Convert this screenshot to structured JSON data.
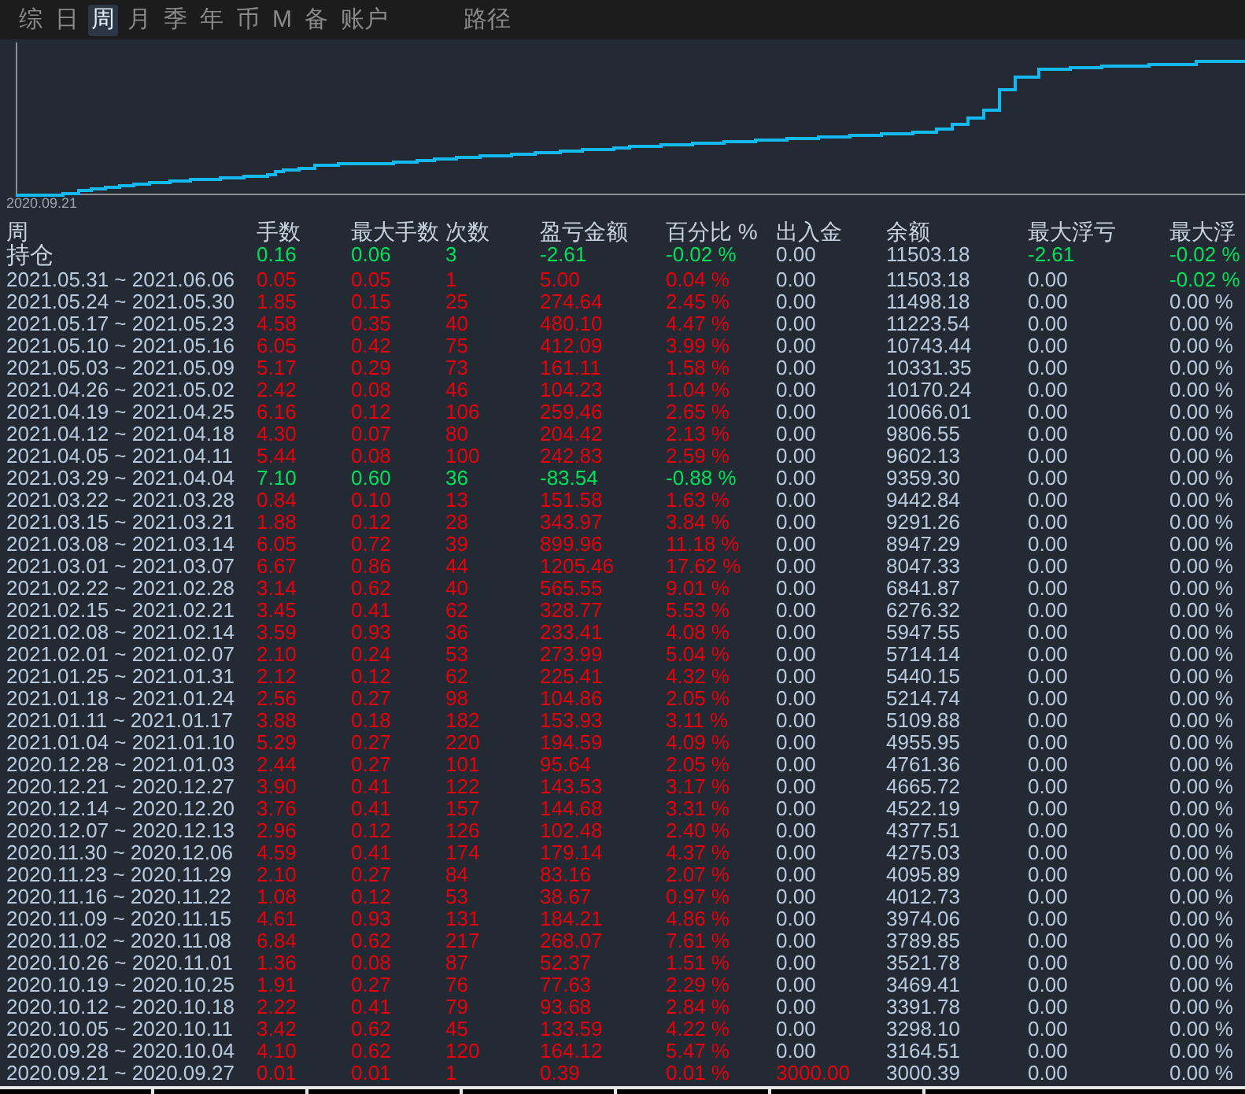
{
  "tabs": [
    {
      "label": "综",
      "selected": false
    },
    {
      "label": "日",
      "selected": false
    },
    {
      "label": "周",
      "selected": true
    },
    {
      "label": "月",
      "selected": false
    },
    {
      "label": "季",
      "selected": false
    },
    {
      "label": "年",
      "selected": false
    },
    {
      "label": "币",
      "selected": false
    },
    {
      "label": "M",
      "selected": false
    },
    {
      "label": "备",
      "selected": false
    },
    {
      "label": "账户",
      "selected": false
    }
  ],
  "path_tab": {
    "label": "路径",
    "selected": false
  },
  "chart": {
    "x_label": "2020.09.21"
  },
  "table": {
    "columns": [
      "周",
      "手数",
      "最大手数",
      "次数",
      "盈亏金额",
      "百分比 %",
      "出入金",
      "余额",
      "最大浮亏",
      "最大浮"
    ],
    "rows": [
      {
        "period": "持仓",
        "negative": true,
        "lots": "0.16",
        "max_lots": "0.06",
        "count": "3",
        "profit": "-2.61",
        "percent": "-0.02 %",
        "deposit": "0.00",
        "deposit_moved": false,
        "balance": "11503.18",
        "max_float": "-2.61",
        "float_negative": true,
        "max_float_pct": "-0.02 %",
        "float_pct_negative": true
      },
      {
        "period": "2021.05.31 ~ 2021.06.06",
        "negative": false,
        "lots": "0.05",
        "max_lots": "0.05",
        "count": "1",
        "profit": "5.00",
        "percent": "0.04 %",
        "deposit": "0.00",
        "deposit_moved": false,
        "balance": "11503.18",
        "max_float": "0.00",
        "float_negative": false,
        "max_float_pct": "-0.02 %",
        "float_pct_negative": true
      },
      {
        "period": "2021.05.24 ~ 2021.05.30",
        "negative": false,
        "lots": "1.85",
        "max_lots": "0.15",
        "count": "25",
        "profit": "274.64",
        "percent": "2.45 %",
        "deposit": "0.00",
        "deposit_moved": false,
        "balance": "11498.18",
        "max_float": "0.00",
        "float_negative": false,
        "max_float_pct": "0.00 %",
        "float_pct_negative": false
      },
      {
        "period": "2021.05.17 ~ 2021.05.23",
        "negative": false,
        "lots": "4.58",
        "max_lots": "0.35",
        "count": "40",
        "profit": "480.10",
        "percent": "4.47 %",
        "deposit": "0.00",
        "deposit_moved": false,
        "balance": "11223.54",
        "max_float": "0.00",
        "float_negative": false,
        "max_float_pct": "0.00 %",
        "float_pct_negative": false
      },
      {
        "period": "2021.05.10 ~ 2021.05.16",
        "negative": false,
        "lots": "6.05",
        "max_lots": "0.42",
        "count": "75",
        "profit": "412.09",
        "percent": "3.99 %",
        "deposit": "0.00",
        "deposit_moved": false,
        "balance": "10743.44",
        "max_float": "0.00",
        "float_negative": false,
        "max_float_pct": "0.00 %",
        "float_pct_negative": false
      },
      {
        "period": "2021.05.03 ~ 2021.05.09",
        "negative": false,
        "lots": "5.17",
        "max_lots": "0.29",
        "count": "73",
        "profit": "161.11",
        "percent": "1.58 %",
        "deposit": "0.00",
        "deposit_moved": false,
        "balance": "10331.35",
        "max_float": "0.00",
        "float_negative": false,
        "max_float_pct": "0.00 %",
        "float_pct_negative": false
      },
      {
        "period": "2021.04.26 ~ 2021.05.02",
        "negative": false,
        "lots": "2.42",
        "max_lots": "0.08",
        "count": "46",
        "profit": "104.23",
        "percent": "1.04 %",
        "deposit": "0.00",
        "deposit_moved": false,
        "balance": "10170.24",
        "max_float": "0.00",
        "float_negative": false,
        "max_float_pct": "0.00 %",
        "float_pct_negative": false
      },
      {
        "period": "2021.04.19 ~ 2021.04.25",
        "negative": false,
        "lots": "6.16",
        "max_lots": "0.12",
        "count": "106",
        "profit": "259.46",
        "percent": "2.65 %",
        "deposit": "0.00",
        "deposit_moved": false,
        "balance": "10066.01",
        "max_float": "0.00",
        "float_negative": false,
        "max_float_pct": "0.00 %",
        "float_pct_negative": false
      },
      {
        "period": "2021.04.12 ~ 2021.04.18",
        "negative": false,
        "lots": "4.30",
        "max_lots": "0.07",
        "count": "80",
        "profit": "204.42",
        "percent": "2.13 %",
        "deposit": "0.00",
        "deposit_moved": false,
        "balance": "9806.55",
        "max_float": "0.00",
        "float_negative": false,
        "max_float_pct": "0.00 %",
        "float_pct_negative": false
      },
      {
        "period": "2021.04.05 ~ 2021.04.11",
        "negative": false,
        "lots": "5.44",
        "max_lots": "0.08",
        "count": "100",
        "profit": "242.83",
        "percent": "2.59 %",
        "deposit": "0.00",
        "deposit_moved": false,
        "balance": "9602.13",
        "max_float": "0.00",
        "float_negative": false,
        "max_float_pct": "0.00 %",
        "float_pct_negative": false
      },
      {
        "period": "2021.03.29 ~ 2021.04.04",
        "negative": true,
        "lots": "7.10",
        "max_lots": "0.60",
        "count": "36",
        "profit": "-83.54",
        "percent": "-0.88 %",
        "deposit": "0.00",
        "deposit_moved": false,
        "balance": "9359.30",
        "max_float": "0.00",
        "float_negative": false,
        "max_float_pct": "0.00 %",
        "float_pct_negative": false
      },
      {
        "period": "2021.03.22 ~ 2021.03.28",
        "negative": false,
        "lots": "0.84",
        "max_lots": "0.10",
        "count": "13",
        "profit": "151.58",
        "percent": "1.63 %",
        "deposit": "0.00",
        "deposit_moved": false,
        "balance": "9442.84",
        "max_float": "0.00",
        "float_negative": false,
        "max_float_pct": "0.00 %",
        "float_pct_negative": false
      },
      {
        "period": "2021.03.15 ~ 2021.03.21",
        "negative": false,
        "lots": "1.88",
        "max_lots": "0.12",
        "count": "28",
        "profit": "343.97",
        "percent": "3.84 %",
        "deposit": "0.00",
        "deposit_moved": false,
        "balance": "9291.26",
        "max_float": "0.00",
        "float_negative": false,
        "max_float_pct": "0.00 %",
        "float_pct_negative": false
      },
      {
        "period": "2021.03.08 ~ 2021.03.14",
        "negative": false,
        "lots": "6.05",
        "max_lots": "0.72",
        "count": "39",
        "profit": "899.96",
        "percent": "11.18 %",
        "deposit": "0.00",
        "deposit_moved": false,
        "balance": "8947.29",
        "max_float": "0.00",
        "float_negative": false,
        "max_float_pct": "0.00 %",
        "float_pct_negative": false
      },
      {
        "period": "2021.03.01 ~ 2021.03.07",
        "negative": false,
        "lots": "6.67",
        "max_lots": "0.86",
        "count": "44",
        "profit": "1205.46",
        "percent": "17.62 %",
        "deposit": "0.00",
        "deposit_moved": false,
        "balance": "8047.33",
        "max_float": "0.00",
        "float_negative": false,
        "max_float_pct": "0.00 %",
        "float_pct_negative": false
      },
      {
        "period": "2021.02.22 ~ 2021.02.28",
        "negative": false,
        "lots": "3.14",
        "max_lots": "0.62",
        "count": "40",
        "profit": "565.55",
        "percent": "9.01 %",
        "deposit": "0.00",
        "deposit_moved": false,
        "balance": "6841.87",
        "max_float": "0.00",
        "float_negative": false,
        "max_float_pct": "0.00 %",
        "float_pct_negative": false
      },
      {
        "period": "2021.02.15 ~ 2021.02.21",
        "negative": false,
        "lots": "3.45",
        "max_lots": "0.41",
        "count": "62",
        "profit": "328.77",
        "percent": "5.53 %",
        "deposit": "0.00",
        "deposit_moved": false,
        "balance": "6276.32",
        "max_float": "0.00",
        "float_negative": false,
        "max_float_pct": "0.00 %",
        "float_pct_negative": false
      },
      {
        "period": "2021.02.08 ~ 2021.02.14",
        "negative": false,
        "lots": "3.59",
        "max_lots": "0.93",
        "count": "36",
        "profit": "233.41",
        "percent": "4.08 %",
        "deposit": "0.00",
        "deposit_moved": false,
        "balance": "5947.55",
        "max_float": "0.00",
        "float_negative": false,
        "max_float_pct": "0.00 %",
        "float_pct_negative": false
      },
      {
        "period": "2021.02.01 ~ 2021.02.07",
        "negative": false,
        "lots": "2.10",
        "max_lots": "0.24",
        "count": "53",
        "profit": "273.99",
        "percent": "5.04 %",
        "deposit": "0.00",
        "deposit_moved": false,
        "balance": "5714.14",
        "max_float": "0.00",
        "float_negative": false,
        "max_float_pct": "0.00 %",
        "float_pct_negative": false
      },
      {
        "period": "2021.01.25 ~ 2021.01.31",
        "negative": false,
        "lots": "2.12",
        "max_lots": "0.12",
        "count": "62",
        "profit": "225.41",
        "percent": "4.32 %",
        "deposit": "0.00",
        "deposit_moved": false,
        "balance": "5440.15",
        "max_float": "0.00",
        "float_negative": false,
        "max_float_pct": "0.00 %",
        "float_pct_negative": false
      },
      {
        "period": "2021.01.18 ~ 2021.01.24",
        "negative": false,
        "lots": "2.56",
        "max_lots": "0.27",
        "count": "98",
        "profit": "104.86",
        "percent": "2.05 %",
        "deposit": "0.00",
        "deposit_moved": false,
        "balance": "5214.74",
        "max_float": "0.00",
        "float_negative": false,
        "max_float_pct": "0.00 %",
        "float_pct_negative": false
      },
      {
        "period": "2021.01.11 ~ 2021.01.17",
        "negative": false,
        "lots": "3.88",
        "max_lots": "0.18",
        "count": "182",
        "profit": "153.93",
        "percent": "3.11 %",
        "deposit": "0.00",
        "deposit_moved": false,
        "balance": "5109.88",
        "max_float": "0.00",
        "float_negative": false,
        "max_float_pct": "0.00 %",
        "float_pct_negative": false
      },
      {
        "period": "2021.01.04 ~ 2021.01.10",
        "negative": false,
        "lots": "5.29",
        "max_lots": "0.27",
        "count": "220",
        "profit": "194.59",
        "percent": "4.09 %",
        "deposit": "0.00",
        "deposit_moved": false,
        "balance": "4955.95",
        "max_float": "0.00",
        "float_negative": false,
        "max_float_pct": "0.00 %",
        "float_pct_negative": false
      },
      {
        "period": "2020.12.28 ~ 2021.01.03",
        "negative": false,
        "lots": "2.44",
        "max_lots": "0.27",
        "count": "101",
        "profit": "95.64",
        "percent": "2.05 %",
        "deposit": "0.00",
        "deposit_moved": false,
        "balance": "4761.36",
        "max_float": "0.00",
        "float_negative": false,
        "max_float_pct": "0.00 %",
        "float_pct_negative": false
      },
      {
        "period": "2020.12.21 ~ 2020.12.27",
        "negative": false,
        "lots": "3.90",
        "max_lots": "0.41",
        "count": "122",
        "profit": "143.53",
        "percent": "3.17 %",
        "deposit": "0.00",
        "deposit_moved": false,
        "balance": "4665.72",
        "max_float": "0.00",
        "float_negative": false,
        "max_float_pct": "0.00 %",
        "float_pct_negative": false
      },
      {
        "period": "2020.12.14 ~ 2020.12.20",
        "negative": false,
        "lots": "3.76",
        "max_lots": "0.41",
        "count": "157",
        "profit": "144.68",
        "percent": "3.31 %",
        "deposit": "0.00",
        "deposit_moved": false,
        "balance": "4522.19",
        "max_float": "0.00",
        "float_negative": false,
        "max_float_pct": "0.00 %",
        "float_pct_negative": false
      },
      {
        "period": "2020.12.07 ~ 2020.12.13",
        "negative": false,
        "lots": "2.96",
        "max_lots": "0.12",
        "count": "126",
        "profit": "102.48",
        "percent": "2.40 %",
        "deposit": "0.00",
        "deposit_moved": false,
        "balance": "4377.51",
        "max_float": "0.00",
        "float_negative": false,
        "max_float_pct": "0.00 %",
        "float_pct_negative": false
      },
      {
        "period": "2020.11.30 ~ 2020.12.06",
        "negative": false,
        "lots": "4.59",
        "max_lots": "0.41",
        "count": "174",
        "profit": "179.14",
        "percent": "4.37 %",
        "deposit": "0.00",
        "deposit_moved": false,
        "balance": "4275.03",
        "max_float": "0.00",
        "float_negative": false,
        "max_float_pct": "0.00 %",
        "float_pct_negative": false
      },
      {
        "period": "2020.11.23 ~ 2020.11.29",
        "negative": false,
        "lots": "2.10",
        "max_lots": "0.27",
        "count": "84",
        "profit": "83.16",
        "percent": "2.07 %",
        "deposit": "0.00",
        "deposit_moved": false,
        "balance": "4095.89",
        "max_float": "0.00",
        "float_negative": false,
        "max_float_pct": "0.00 %",
        "float_pct_negative": false
      },
      {
        "period": "2020.11.16 ~ 2020.11.22",
        "negative": false,
        "lots": "1.08",
        "max_lots": "0.12",
        "count": "53",
        "profit": "38.67",
        "percent": "0.97 %",
        "deposit": "0.00",
        "deposit_moved": false,
        "balance": "4012.73",
        "max_float": "0.00",
        "float_negative": false,
        "max_float_pct": "0.00 %",
        "float_pct_negative": false
      },
      {
        "period": "2020.11.09 ~ 2020.11.15",
        "negative": false,
        "lots": "4.61",
        "max_lots": "0.93",
        "count": "131",
        "profit": "184.21",
        "percent": "4.86 %",
        "deposit": "0.00",
        "deposit_moved": false,
        "balance": "3974.06",
        "max_float": "0.00",
        "float_negative": false,
        "max_float_pct": "0.00 %",
        "float_pct_negative": false
      },
      {
        "period": "2020.11.02 ~ 2020.11.08",
        "negative": false,
        "lots": "6.84",
        "max_lots": "0.62",
        "count": "217",
        "profit": "268.07",
        "percent": "7.61 %",
        "deposit": "0.00",
        "deposit_moved": false,
        "balance": "3789.85",
        "max_float": "0.00",
        "float_negative": false,
        "max_float_pct": "0.00 %",
        "float_pct_negative": false
      },
      {
        "period": "2020.10.26 ~ 2020.11.01",
        "negative": false,
        "lots": "1.36",
        "max_lots": "0.08",
        "count": "87",
        "profit": "52.37",
        "percent": "1.51 %",
        "deposit": "0.00",
        "deposit_moved": false,
        "balance": "3521.78",
        "max_float": "0.00",
        "float_negative": false,
        "max_float_pct": "0.00 %",
        "float_pct_negative": false
      },
      {
        "period": "2020.10.19 ~ 2020.10.25",
        "negative": false,
        "lots": "1.91",
        "max_lots": "0.27",
        "count": "76",
        "profit": "77.63",
        "percent": "2.29 %",
        "deposit": "0.00",
        "deposit_moved": false,
        "balance": "3469.41",
        "max_float": "0.00",
        "float_negative": false,
        "max_float_pct": "0.00 %",
        "float_pct_negative": false
      },
      {
        "period": "2020.10.12 ~ 2020.10.18",
        "negative": false,
        "lots": "2.22",
        "max_lots": "0.41",
        "count": "79",
        "profit": "93.68",
        "percent": "2.84 %",
        "deposit": "0.00",
        "deposit_moved": false,
        "balance": "3391.78",
        "max_float": "0.00",
        "float_negative": false,
        "max_float_pct": "0.00 %",
        "float_pct_negative": false
      },
      {
        "period": "2020.10.05 ~ 2020.10.11",
        "negative": false,
        "lots": "3.42",
        "max_lots": "0.62",
        "count": "45",
        "profit": "133.59",
        "percent": "4.22 %",
        "deposit": "0.00",
        "deposit_moved": false,
        "balance": "3298.10",
        "max_float": "0.00",
        "float_negative": false,
        "max_float_pct": "0.00 %",
        "float_pct_negative": false
      },
      {
        "period": "2020.09.28 ~ 2020.10.04",
        "negative": false,
        "lots": "4.10",
        "max_lots": "0.62",
        "count": "120",
        "profit": "164.12",
        "percent": "5.47 %",
        "deposit": "0.00",
        "deposit_moved": false,
        "balance": "3164.51",
        "max_float": "0.00",
        "float_negative": false,
        "max_float_pct": "0.00 %",
        "float_pct_negative": false
      },
      {
        "period": "2020.09.21 ~ 2020.09.27",
        "negative": false,
        "lots": "0.01",
        "max_lots": "0.01",
        "count": "1",
        "profit": "0.39",
        "percent": "0.01 %",
        "deposit": "3000.00",
        "deposit_moved": true,
        "balance": "3000.39",
        "max_float": "0.00",
        "float_negative": false,
        "max_float_pct": "0.00 %",
        "float_pct_negative": false
      }
    ]
  }
}
